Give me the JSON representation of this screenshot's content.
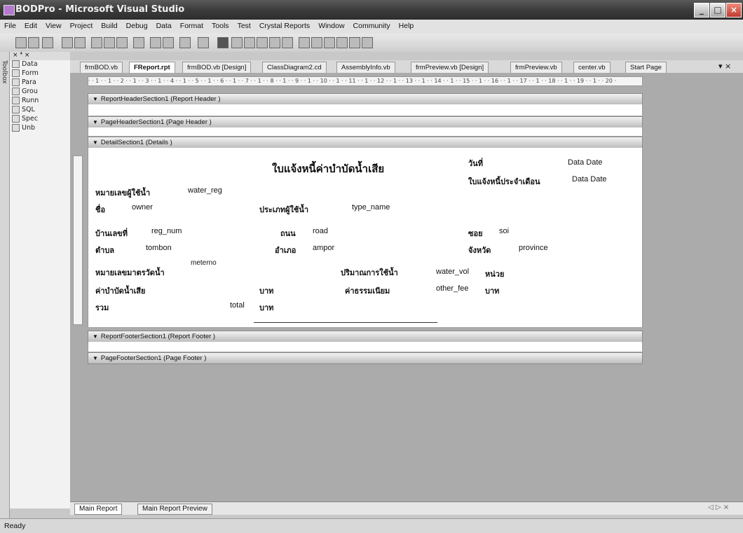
{
  "window": {
    "title": "BODPro - Microsoft Visual Studio",
    "controls": [
      "_",
      "□",
      "×"
    ]
  },
  "menu": [
    "File",
    "Edit",
    "View",
    "Project",
    "Build",
    "Debug",
    "Data",
    "Format",
    "Tools",
    "Test",
    "Crystal Reports",
    "Window",
    "Community",
    "Help"
  ],
  "toolbox": {
    "tab_label": "Toolbox",
    "header": "× ⁴ ×",
    "items": [
      "Data",
      "Form",
      "Para",
      "Grou",
      "Runn",
      "SQL",
      "Spec",
      "Unb"
    ]
  },
  "tabs": [
    {
      "label": "frmBOD.vb",
      "active": false
    },
    {
      "label": "FReport.rpt",
      "active": true
    },
    {
      "label": "frmBOD.vb [Design]",
      "active": false
    },
    {
      "label": "ClassDiagram2.cd",
      "active": false
    },
    {
      "label": "AssemblyInfo.vb",
      "active": false
    },
    {
      "label": "frmPreview.vb [Design]",
      "active": false
    },
    {
      "label": "frmPreview.vb",
      "active": false
    },
    {
      "label": "center.vb",
      "active": false
    },
    {
      "label": "Start Page",
      "active": false
    }
  ],
  "tab_overflow": "▾ ×",
  "ruler_text": "· · 1 · · 1 · · 2 · · 1 · · 3 · · 1 · · 4 · · 1 · · 5 · · 1 · · 6 · · 1 · · 7 · · 1 · · 8 · · 1 · · 9 · · 1 · · 10 · · 1 · · 11 · · 1 · · 12 · · 1 · · 13 · · 1 · · 14 · · 1 · · 15 · · 1 · · 16 · · 1 · · 17 · · 1 · · 18 · · 1 · · 19 · · 1 · · 20 ·",
  "sections": {
    "report_header": "ReportHeaderSection1 (Report Header )",
    "page_header": "PageHeaderSection1 (Page Header )",
    "details": "DetailSection1 (Details )",
    "report_footer": "ReportFooterSection1 (Report Footer )",
    "page_footer": "PageFooterSection1 (Page Footer )"
  },
  "report": {
    "title": "ใบแจ้งหนี้ค่าบำบัดน้ำเสีย",
    "date_label": "วันที่",
    "date_field": "Data Date",
    "monthly_label": "ใบแจ้งหนี้ประจำเดือน",
    "monthly_field": "Data Date",
    "water_reg_label": "หมายเลขผู้ใช้น้ำ",
    "water_reg_field": "water_reg",
    "name_label": "ชื่อ",
    "owner_field": "owner",
    "type_label": "ประเภทผู้ใช้น้ำ",
    "type_field": "type_name",
    "house_label": "บ้านเลขที่",
    "reg_num_field": "reg_num",
    "road_label": "ถนน",
    "road_field": "road",
    "soi_label": "ซอย",
    "soi_field": "soi",
    "tambon_label": "ตำบล",
    "tambon_field": "tombon",
    "amphoe_label": "อำเภอ",
    "amphoe_field": "ampor",
    "province_label": "จังหวัด",
    "province_field": "province",
    "meter_label": "หมายเลขมาตรวัดน้ำ",
    "meter_field": "meterno",
    "volume_label": "ปริมาณการใช้น้ำ",
    "volume_field": "water_vol",
    "unit_label": "หน่วย",
    "fee_label": "ค่าบำบัดน้ำเสีย",
    "baht1": "บาท",
    "other_label": "ค่าธรรมเนียม",
    "other_field": "other_fee",
    "baht2": "บาท",
    "total_label": "รวม",
    "total_field": "total",
    "baht3": "บาท"
  },
  "bottom_tabs": [
    "Main Report",
    "Main Report Preview"
  ],
  "bottom_nav": "◁ ▷ ×",
  "status": "Ready"
}
